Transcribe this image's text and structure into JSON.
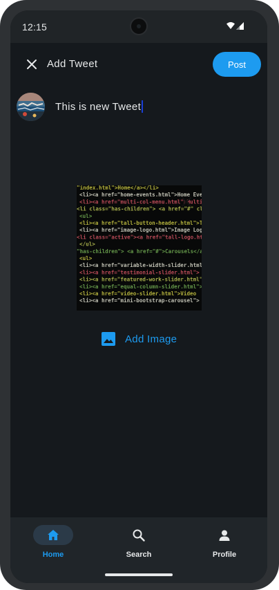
{
  "status_bar": {
    "time": "12:15"
  },
  "app_bar": {
    "title": "Add Tweet",
    "post_label": "Post"
  },
  "composer": {
    "text": "This is new Tweet"
  },
  "attachment": {
    "add_image_label": "Add Image",
    "code_lines": [
      "\"index.html\">Home</a></li>",
      "<li><a href=\"home-events.html\">Home Events</a></li>",
      "<li><a href=\"multi-col-menu.html\">Multiple Column Menu</a></li>",
      "<li class=\"has-children\"> <a href=\"#\" class=\"current\"",
      "<ul>",
      "<li><a href=\"tall-button-header.html\">Tall Button",
      "<li><a href=\"image-logo.html\">Image Logo</a>",
      "<li class=\"active\"><a href=\"tall-logo.html\">",
      "</ul>",
      "\"has-children\"> <a href=\"#\">Carousels</a>",
      "<ul>",
      "<li><a href=\"variable-width-slider.html\">",
      "<li><a href=\"testimonial-slider.html\">",
      "<li><a href=\"featured-work-slider.html\">",
      "<li><a href=\"equal-column-slider.html\">",
      "<li><a href=\"video-slider.html\">Video",
      "<li><a href=\"mini-bootstrap-carousel\">"
    ]
  },
  "nav": {
    "items": [
      {
        "label": "Home",
        "icon": "home-icon",
        "active": true
      },
      {
        "label": "Search",
        "icon": "search-icon",
        "active": false
      },
      {
        "label": "Profile",
        "icon": "person-icon",
        "active": false
      }
    ]
  },
  "colors": {
    "accent": "#1d9bf0",
    "background": "#15191d",
    "surface": "#202529",
    "text": "#e7e9ea"
  }
}
